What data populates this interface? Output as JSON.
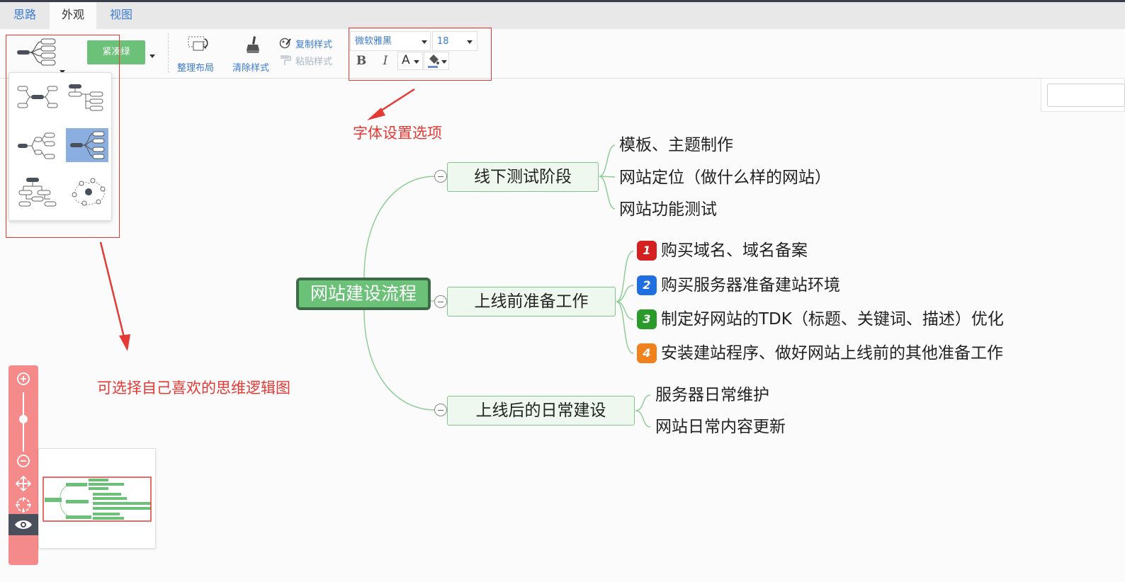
{
  "tabs": [
    {
      "label": "思路",
      "active": false
    },
    {
      "label": "外观",
      "active": true
    },
    {
      "label": "视图",
      "active": false
    }
  ],
  "toolbar": {
    "theme_label": "紧凑绿",
    "arrange_label": "整理布局",
    "clear_style_label": "清除样式",
    "copy_style_label": "复制样式",
    "paste_style_label": "粘贴样式",
    "font_family": "微软雅黑",
    "font_size": "18",
    "bold_label": "B",
    "italic_label": "I",
    "font_color_label": "A"
  },
  "layouts": [
    {
      "icon": "mindmap-balanced-icon",
      "selected": false
    },
    {
      "icon": "org-tree-icon",
      "selected": false
    },
    {
      "icon": "logic-tree-icon",
      "selected": false
    },
    {
      "icon": "mindmap-right-icon",
      "selected": true
    },
    {
      "icon": "org-chart-icon",
      "selected": false
    },
    {
      "icon": "fishbone-network-icon",
      "selected": false
    }
  ],
  "annotations": {
    "font_settings": "字体设置选项",
    "layout_choice": "可选择自己喜欢的思维逻辑图"
  },
  "mindmap": {
    "root": "网站建设流程",
    "branches": [
      {
        "label": "线下测试阶段",
        "children": [
          {
            "text": "模板、主题制作"
          },
          {
            "text": "网站定位（做什么样的网站）"
          },
          {
            "text": "网站功能测试"
          }
        ]
      },
      {
        "label": "上线前准备工作",
        "children": [
          {
            "text": "购买域名、域名备案",
            "priority": "1"
          },
          {
            "text": "购买服务器准备建站环境",
            "priority": "2"
          },
          {
            "text": "制定好网站的TDK（标题、关键词、描述）优化",
            "priority": "3"
          },
          {
            "text": "安装建站程序、做好网站上线前的其他准备工作",
            "priority": "4"
          }
        ]
      },
      {
        "label": "上线后的日常建设",
        "children": [
          {
            "text": "服务器日常维护"
          },
          {
            "text": "网站日常内容更新"
          }
        ]
      }
    ]
  },
  "colors": {
    "accent_green": "#6cc179",
    "root_border": "#3d6b47",
    "annotation_red": "#e53935",
    "zoom_bar": "#f58a8a",
    "priority_1": "#d42020",
    "priority_2": "#1f6fe0",
    "priority_3": "#2a9a2a",
    "priority_4": "#f0821e"
  }
}
